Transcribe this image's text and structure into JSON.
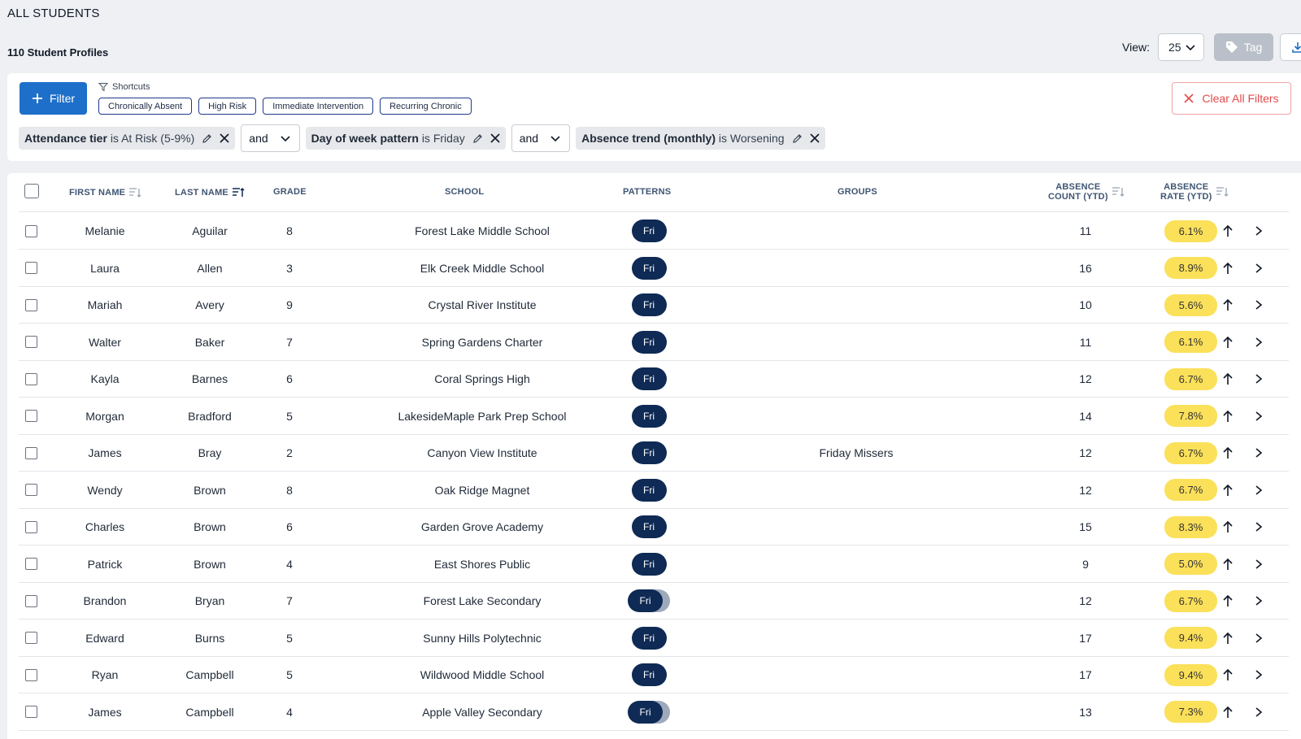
{
  "page": {
    "title": "ALL STUDENTS",
    "profile_count": "110 Student Profiles"
  },
  "toolbar": {
    "view_label": "View:",
    "view_value": "25",
    "tag_label": "Tag"
  },
  "filters": {
    "filter_button_label": "Filter",
    "shortcuts_label": "Shortcuts",
    "shortcuts": [
      "Chronically Absent",
      "High Risk",
      "Immediate Intervention",
      "Recurring Chronic"
    ],
    "clear_label": "Clear All Filters",
    "conditions": [
      {
        "field": "Attendance tier",
        "op": "is",
        "value": "At Risk (5-9%)"
      },
      {
        "field": "Day of week pattern",
        "op": "is",
        "value": "Friday"
      },
      {
        "field": "Absence trend (monthly)",
        "op": "is",
        "value": "Worsening"
      }
    ],
    "conjunctions": [
      "and",
      "and"
    ]
  },
  "table": {
    "columns": {
      "first_name": "FIRST NAME",
      "last_name": "LAST NAME",
      "grade": "GRADE",
      "school": "SCHOOL",
      "patterns": "PATTERNS",
      "groups": "GROUPS",
      "absence_count_1": "ABSENCE",
      "absence_count_2": "COUNT (YTD)",
      "absence_rate_1": "ABSENCE",
      "absence_rate_2": "RATE (YTD)"
    },
    "rows": [
      {
        "first": "Melanie",
        "last": "Aguilar",
        "grade": "8",
        "school": "Forest Lake Middle School",
        "pattern": "Fri",
        "stacked": false,
        "group": "",
        "count": "11",
        "rate": "6.1%"
      },
      {
        "first": "Laura",
        "last": "Allen",
        "grade": "3",
        "school": "Elk Creek Middle School",
        "pattern": "Fri",
        "stacked": false,
        "group": "",
        "count": "16",
        "rate": "8.9%"
      },
      {
        "first": "Mariah",
        "last": "Avery",
        "grade": "9",
        "school": "Crystal River Institute",
        "pattern": "Fri",
        "stacked": false,
        "group": "",
        "count": "10",
        "rate": "5.6%"
      },
      {
        "first": "Walter",
        "last": "Baker",
        "grade": "7",
        "school": "Spring Gardens Charter",
        "pattern": "Fri",
        "stacked": false,
        "group": "",
        "count": "11",
        "rate": "6.1%"
      },
      {
        "first": "Kayla",
        "last": "Barnes",
        "grade": "6",
        "school": "Coral Springs High",
        "pattern": "Fri",
        "stacked": false,
        "group": "",
        "count": "12",
        "rate": "6.7%"
      },
      {
        "first": "Morgan",
        "last": "Bradford",
        "grade": "5",
        "school": "LakesideMaple Park Prep School",
        "pattern": "Fri",
        "stacked": false,
        "group": "",
        "count": "14",
        "rate": "7.8%"
      },
      {
        "first": "James",
        "last": "Bray",
        "grade": "2",
        "school": "Canyon View Institute",
        "pattern": "Fri",
        "stacked": false,
        "group": "Friday Missers",
        "count": "12",
        "rate": "6.7%"
      },
      {
        "first": "Wendy",
        "last": "Brown",
        "grade": "8",
        "school": "Oak Ridge Magnet",
        "pattern": "Fri",
        "stacked": false,
        "group": "",
        "count": "12",
        "rate": "6.7%"
      },
      {
        "first": "Charles",
        "last": "Brown",
        "grade": "6",
        "school": "Garden Grove Academy",
        "pattern": "Fri",
        "stacked": false,
        "group": "",
        "count": "15",
        "rate": "8.3%"
      },
      {
        "first": "Patrick",
        "last": "Brown",
        "grade": "4",
        "school": "East Shores Public",
        "pattern": "Fri",
        "stacked": false,
        "group": "",
        "count": "9",
        "rate": "5.0%"
      },
      {
        "first": "Brandon",
        "last": "Bryan",
        "grade": "7",
        "school": "Forest Lake Secondary",
        "pattern": "Fri",
        "stacked": true,
        "group": "",
        "count": "12",
        "rate": "6.7%"
      },
      {
        "first": "Edward",
        "last": "Burns",
        "grade": "5",
        "school": "Sunny Hills Polytechnic",
        "pattern": "Fri",
        "stacked": false,
        "group": "",
        "count": "17",
        "rate": "9.4%"
      },
      {
        "first": "Ryan",
        "last": "Campbell",
        "grade": "5",
        "school": "Wildwood Middle School",
        "pattern": "Fri",
        "stacked": false,
        "group": "",
        "count": "17",
        "rate": "9.4%"
      },
      {
        "first": "James",
        "last": "Campbell",
        "grade": "4",
        "school": "Apple Valley Secondary",
        "pattern": "Fri",
        "stacked": true,
        "group": "",
        "count": "13",
        "rate": "7.3%"
      }
    ]
  },
  "colors": {
    "primary": "#1e6fc9",
    "pattern_pill": "#0e2a55",
    "rate_pill": "#fbe05a",
    "clear_filters": "#e24b4b"
  }
}
